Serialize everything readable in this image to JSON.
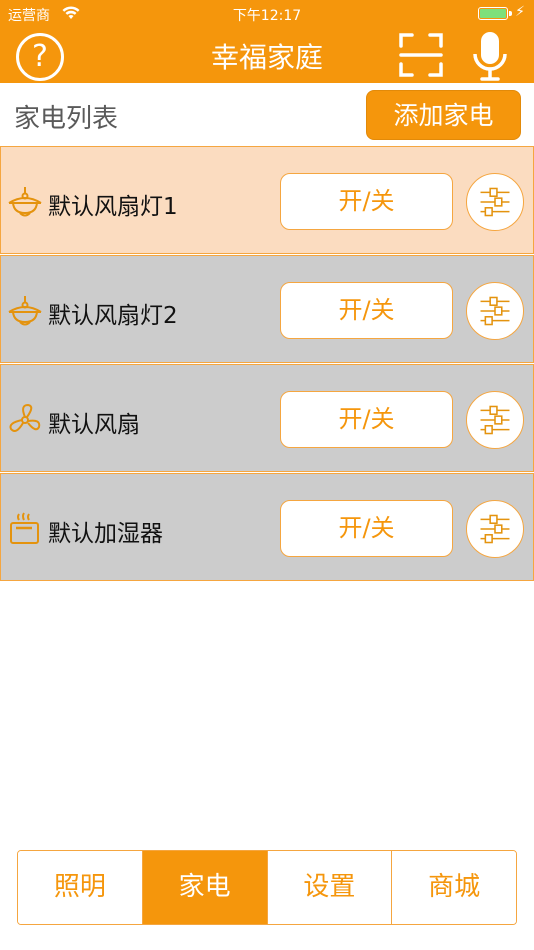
{
  "status_bar": {
    "carrier": "运营商",
    "time": "下午12:17"
  },
  "nav": {
    "title": "幸福家庭",
    "help_glyph": "?"
  },
  "section": {
    "label": "家电列表",
    "add_button": "添加家电"
  },
  "colors": {
    "accent": "#f5960c",
    "row_active": "#fbdcc0",
    "row_inactive": "#cccccc"
  },
  "devices": [
    {
      "name": "默认风扇灯1",
      "icon": "ceiling-fan-light-icon",
      "toggle_label": "开/关",
      "selected": true
    },
    {
      "name": "默认风扇灯2",
      "icon": "ceiling-fan-light-icon",
      "toggle_label": "开/关",
      "selected": false
    },
    {
      "name": "默认风扇",
      "icon": "fan-icon",
      "toggle_label": "开/关",
      "selected": false
    },
    {
      "name": "默认加湿器",
      "icon": "humidifier-icon",
      "toggle_label": "开/关",
      "selected": false
    }
  ],
  "tabs": [
    {
      "label": "照明",
      "active": false
    },
    {
      "label": "家电",
      "active": true
    },
    {
      "label": "设置",
      "active": false
    },
    {
      "label": "商城",
      "active": false
    }
  ]
}
